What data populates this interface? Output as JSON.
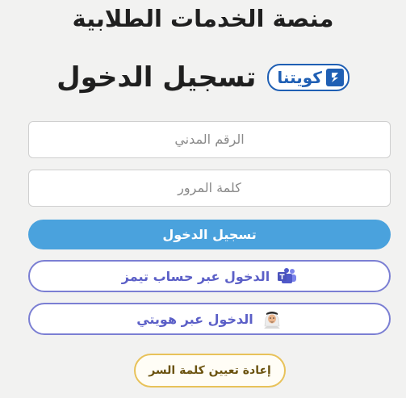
{
  "header": {
    "platform_title": "منصة الخدمات الطلابية",
    "login_title": "تسجيل الدخول",
    "logo_text": "كويتنا"
  },
  "form": {
    "civil_id_placeholder": "الرقم المدني",
    "password_placeholder": "كلمة المرور"
  },
  "buttons": {
    "login": "تسجيل الدخول",
    "teams_login": "الدخول عبر حساب تيمز",
    "hawyti_login": "الدخول عبر هويتي",
    "reset_password": "إعادة تعيين كلمة السر"
  },
  "icons": {
    "teams": "microsoft-teams-icon",
    "hawyti": "hawyti-avatar-icon",
    "logo": "kuwaiti-logo-icon"
  },
  "colors": {
    "primary": "#4aa2dd",
    "outline": "#7b7fd3",
    "reset_border": "#e8c25a",
    "logo_blue": "#1f5fb4"
  }
}
